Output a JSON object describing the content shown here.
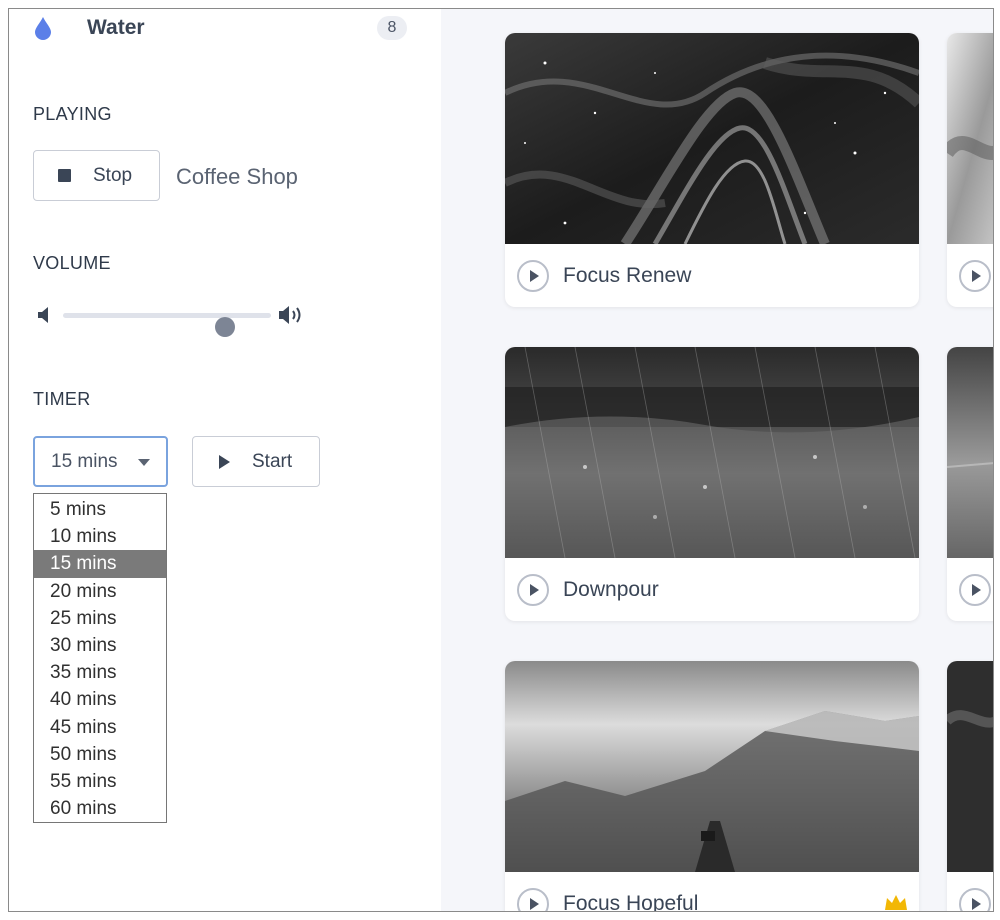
{
  "sidebar": {
    "category": {
      "label": "Water",
      "count": "8",
      "icon": "water-drop-icon",
      "icon_color": "#5b7fe8"
    },
    "playing": {
      "title": "PLAYING",
      "stop_label": "Stop",
      "now_playing": "Coffee Shop"
    },
    "volume": {
      "title": "VOLUME",
      "level": 0.78
    },
    "timer": {
      "title": "TIMER",
      "selected": "15 mins",
      "start_label": "Start",
      "options": [
        "5 mins",
        "10 mins",
        "15 mins",
        "20 mins",
        "25 mins",
        "30 mins",
        "35 mins",
        "40 mins",
        "45 mins",
        "50 mins",
        "55 mins",
        "60 mins"
      ]
    }
  },
  "main": {
    "cards": [
      {
        "title": "Focus Renew"
      },
      {
        "title": "Downpour"
      },
      {
        "title": "Focus Hopeful",
        "premium_icon": "crown-icon"
      }
    ]
  },
  "colors": {
    "accent_focus": "#7aa3de",
    "crown": "#f2b705",
    "selected_option": "#7a7a7a"
  }
}
